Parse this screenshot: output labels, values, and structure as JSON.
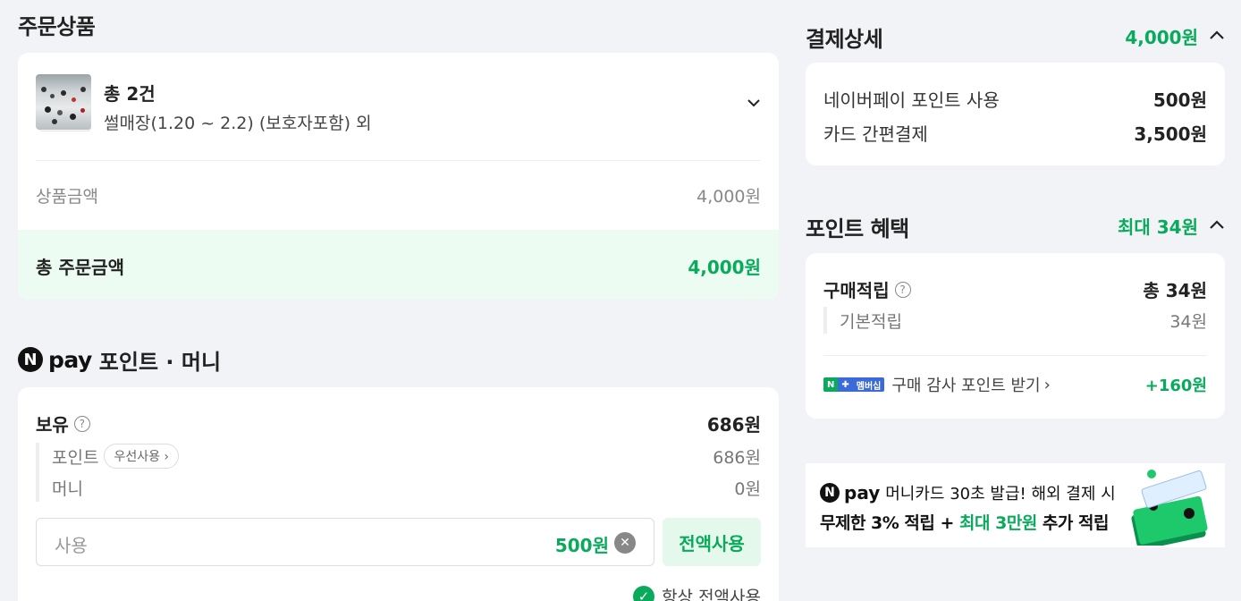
{
  "order": {
    "title": "주문상품",
    "count_label": "총 2건",
    "product_name": "썰매장(1.20 ~ 2.2) (보호자포함) 외",
    "price_label": "상품금액",
    "price_value": "4,000원",
    "total_label": "총 주문금액",
    "total_value": "4,000원"
  },
  "npay": {
    "logo_n": "N",
    "logo_pay": "pay",
    "title": "포인트 · 머니",
    "own_label": "보유",
    "own_value": "686원",
    "point_label": "포인트",
    "point_pill": "우선사용",
    "point_value": "686원",
    "money_label": "머니",
    "money_value": "0원",
    "use_placeholder": "사용",
    "use_value": "500원",
    "all_use_button": "전액사용",
    "always_all_use": "항상 전액사용"
  },
  "payment": {
    "title": "결제상세",
    "total": "4,000원",
    "lines": [
      {
        "label": "네이버페이 포인트 사용",
        "value": "500원"
      },
      {
        "label": "카드 간편결제",
        "value": "3,500원"
      }
    ]
  },
  "points": {
    "title": "포인트 혜택",
    "max": "최대 34원",
    "purchase_label": "구매적립",
    "purchase_value": "총 34원",
    "basic_label": "기본적립",
    "basic_value": "34원",
    "badge_a": "N",
    "badge_b": "멤버십",
    "thanks_label": "구매 감사 포인트 받기",
    "thanks_value": "+160원"
  },
  "banner": {
    "n": "N",
    "pay": "pay",
    "line1": "머니카드 30초 발급! 해외 결제 시",
    "line2_a": "무제한 3% 적립 + ",
    "line2_b": "최대 3만원",
    "line2_c": " 추가 적립"
  },
  "colors": {
    "accent": "#09aa5c",
    "background": "#f2f3f6"
  }
}
